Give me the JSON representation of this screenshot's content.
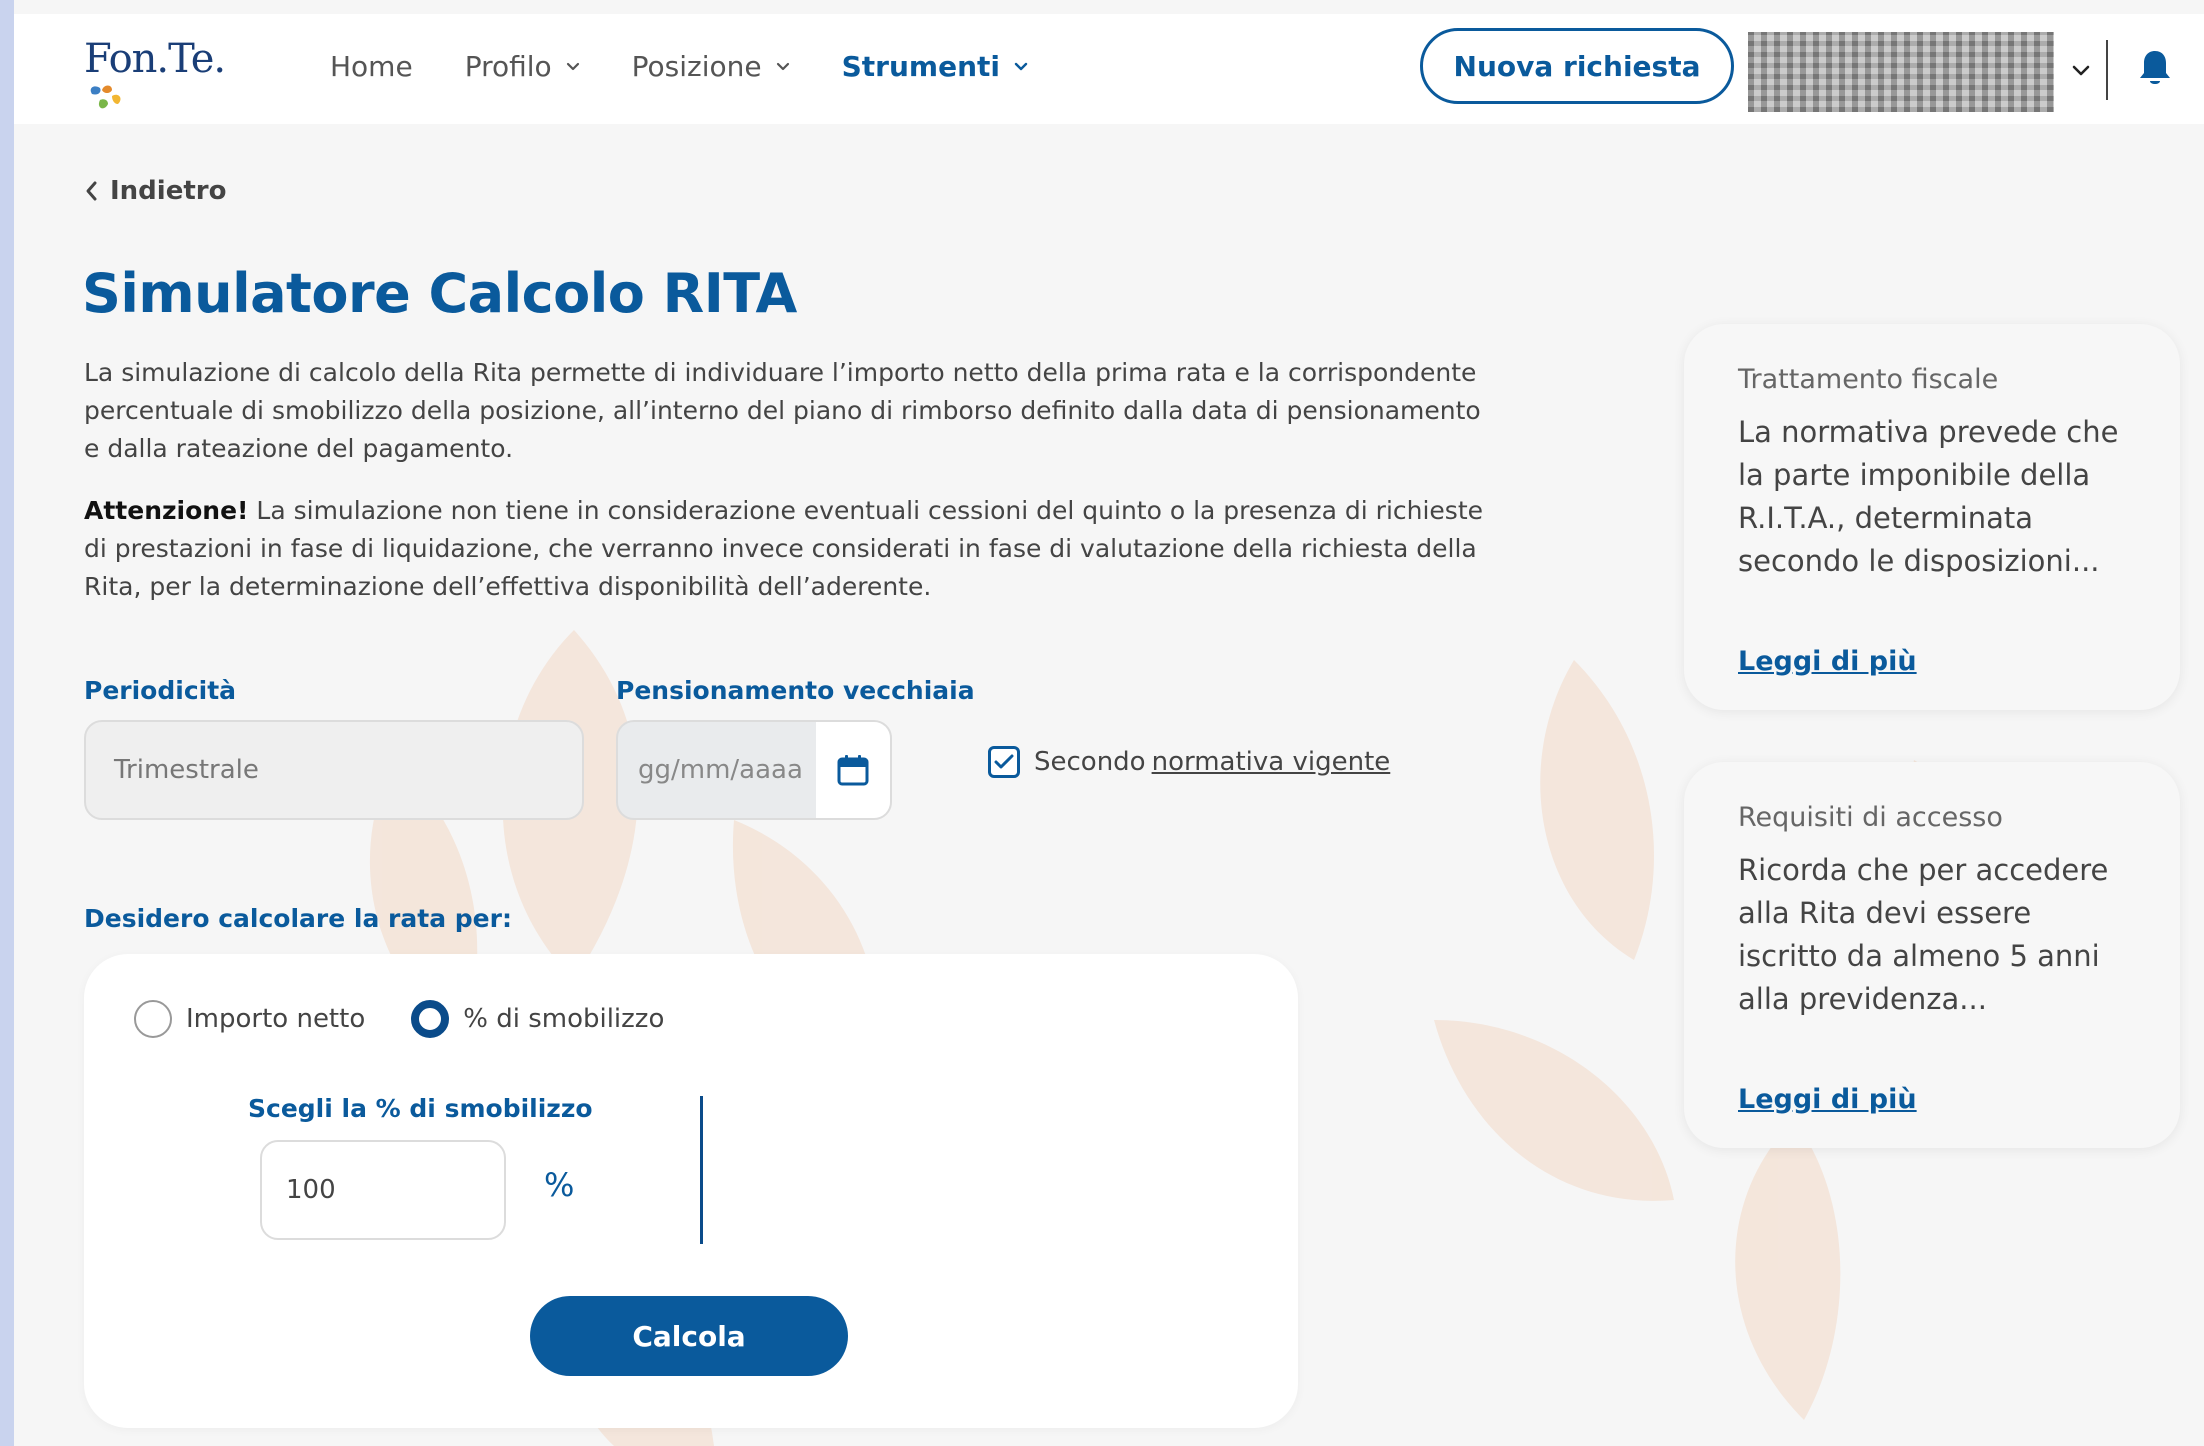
{
  "header": {
    "logo_text": "Fon.Te.",
    "nav": [
      {
        "label": "Home"
      },
      {
        "label": "Profilo"
      },
      {
        "label": "Posizione"
      },
      {
        "label": "Strumenti"
      }
    ],
    "new_request_label": "Nuova richiesta",
    "icons": [
      "chevron-down-icon",
      "bell-icon",
      "avatar-blurred"
    ]
  },
  "back_label": "Indietro",
  "page_title": "Simulatore Calcolo RITA",
  "intro": "La simulazione di calcolo della Rita permette di individuare l’importo netto della prima rata e la corrispondente percentuale di smobilizzo della posizione, all’interno del piano di rimborso definito dalla data di pensionamento e dalla rateazione del pagamento.",
  "warning": {
    "bold": "Attenzione!",
    "text": " La simulazione non tiene in considerazione eventuali cessioni del quinto o la presenza di richieste di prestazioni in fase di liquidazione, che verranno invece considerati in fase di valutazione della richiesta della Rita, per la determinazione dell’effettiva disponibilità dell’aderente."
  },
  "form": {
    "periodicity_label": "Periodicità",
    "periodicity_value": "Trimestrale",
    "retirement_label": "Pensionamento vecchiaia",
    "retirement_placeholder": "gg/mm/aaaa",
    "checkbox_prefix": "Secondo",
    "checkbox_link": "normativa vigente",
    "checkbox_checked": true,
    "calc_for_label": "Desidero calcolare la rata per:"
  },
  "calc_card": {
    "radio_net": "Importo netto",
    "radio_pct": "% di smobilizzo",
    "selected": "pct",
    "pct_label": "Scegli la % di smobilizzo",
    "pct_value": "100",
    "pct_sign": "%",
    "button_label": "Calcola"
  },
  "sidebar": {
    "cards": [
      {
        "title": "Trattamento fiscale",
        "text": "La normativa prevede che la parte imponibile della R.I.T.A., determinata secondo le disposizioni...",
        "link": "Leggi di più"
      },
      {
        "title": "Requisiti di accesso",
        "text": "Ricorda che per accedere alla Rita devi essere iscritto da almeno 5 anni alla previdenza...",
        "link": "Leggi di più"
      }
    ]
  },
  "colors": {
    "primary": "#0a5a9c",
    "background": "#f6f6f6",
    "frame": "#c9d3ee"
  }
}
